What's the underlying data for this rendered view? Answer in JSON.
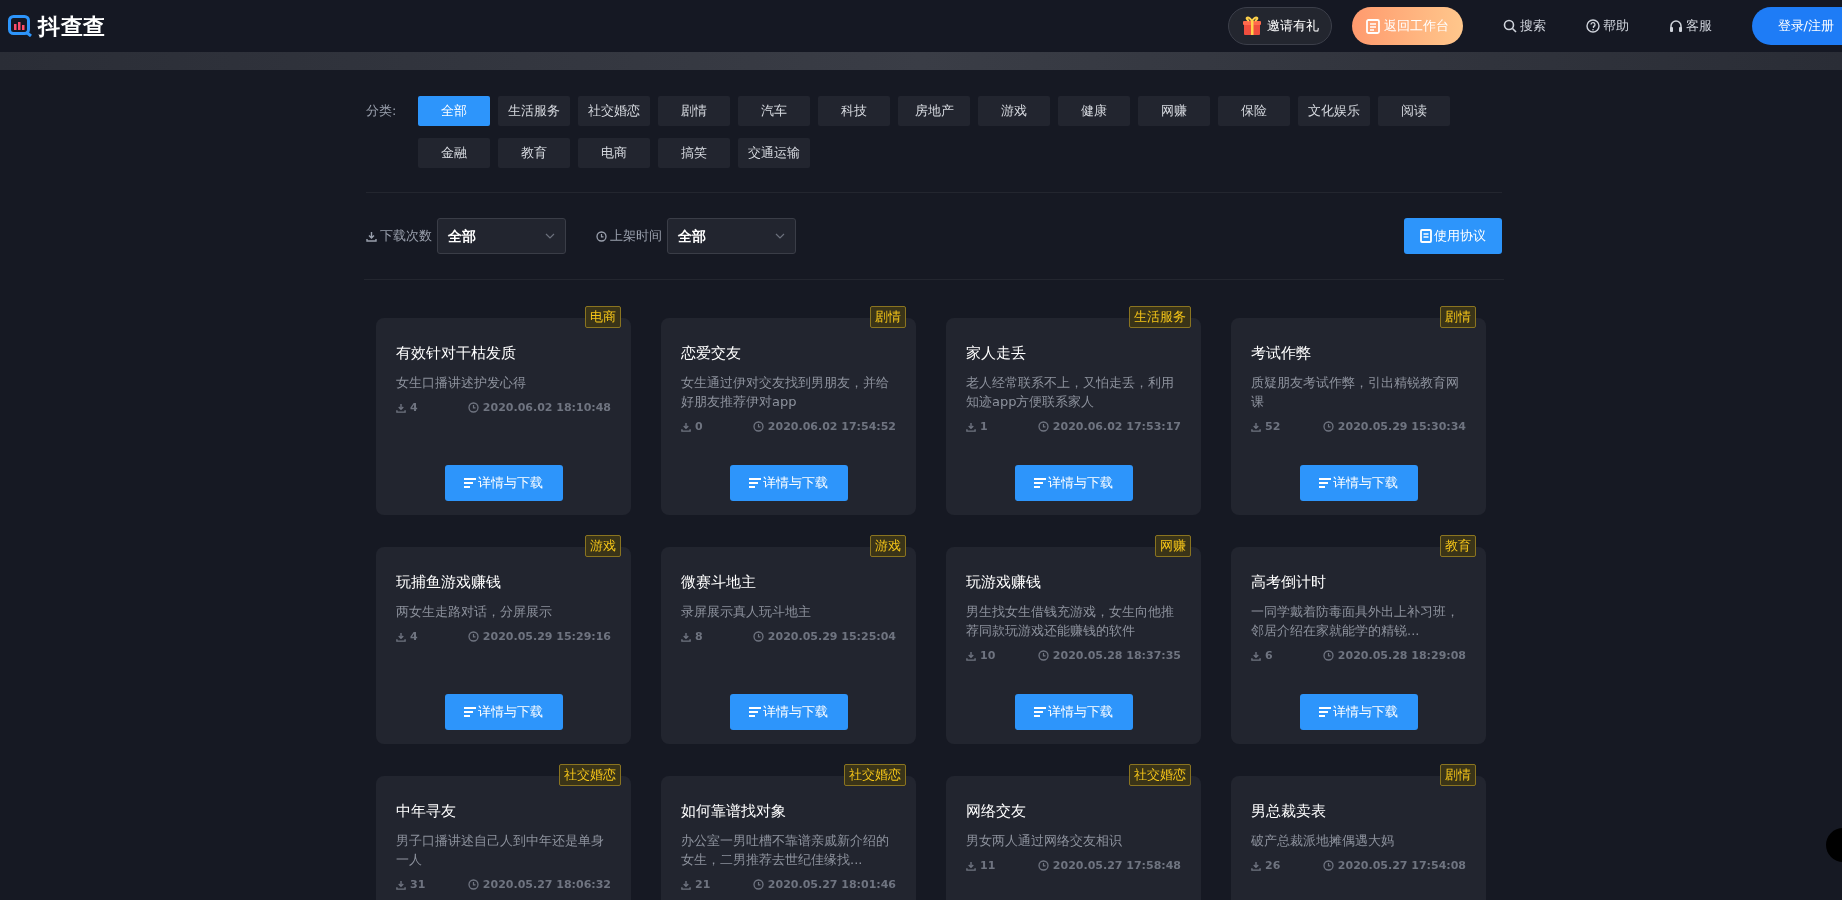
{
  "header": {
    "logo": "抖查查",
    "invite": "邀请有礼",
    "workbench": "返回工作台",
    "nav": [
      {
        "kind": "search",
        "label": "搜索"
      },
      {
        "kind": "help",
        "label": "帮助"
      },
      {
        "kind": "service",
        "label": "客服"
      }
    ],
    "login": "登录/注册"
  },
  "categories": {
    "label": "分类:",
    "items": [
      {
        "label": "全部",
        "selected": true
      },
      {
        "label": "生活服务",
        "selected": false
      },
      {
        "label": "社交婚恋",
        "selected": false
      },
      {
        "label": "剧情",
        "selected": false
      },
      {
        "label": "汽车",
        "selected": false
      },
      {
        "label": "科技",
        "selected": false
      },
      {
        "label": "房地产",
        "selected": false
      },
      {
        "label": "游戏",
        "selected": false
      },
      {
        "label": "健康",
        "selected": false
      },
      {
        "label": "网赚",
        "selected": false
      },
      {
        "label": "保险",
        "selected": false
      },
      {
        "label": "文化娱乐",
        "selected": false
      },
      {
        "label": "阅读",
        "selected": false
      },
      {
        "label": "金融",
        "selected": false
      },
      {
        "label": "教育",
        "selected": false
      },
      {
        "label": "电商",
        "selected": false
      },
      {
        "label": "搞笑",
        "selected": false
      },
      {
        "label": "交通运输",
        "selected": false
      }
    ]
  },
  "filters": [
    {
      "kind": "download",
      "label": "下载次数",
      "value": "全部"
    },
    {
      "kind": "time",
      "label": "上架时间",
      "value": "全部"
    }
  ],
  "agreement_button": "使用协议",
  "cards": [
    {
      "tag": "电商",
      "title": "有效针对干枯发质",
      "description": "女生口播讲述护发心得",
      "downloads": "4",
      "time": "2020.06.02 18:10:48",
      "button": "详情与下载"
    },
    {
      "tag": "剧情",
      "title": "恋爱交友",
      "description": "女生通过伊对交友找到男朋友，并给好朋友推荐伊对app",
      "downloads": "0",
      "time": "2020.06.02 17:54:52",
      "button": "详情与下载"
    },
    {
      "tag": "生活服务",
      "title": "家人走丢",
      "description": "老人经常联系不上，又怕走丢，利用知迹app方便联系家人",
      "downloads": "1",
      "time": "2020.06.02 17:53:17",
      "button": "详情与下载"
    },
    {
      "tag": "剧情",
      "title": "考试作弊",
      "description": "质疑朋友考试作弊，引出精锐教育网课",
      "downloads": "52",
      "time": "2020.05.29 15:30:34",
      "button": "详情与下载"
    },
    {
      "tag": "游戏",
      "title": "玩捕鱼游戏赚钱",
      "description": "两女生走路对话，分屏展示",
      "downloads": "4",
      "time": "2020.05.29 15:29:16",
      "button": "详情与下载"
    },
    {
      "tag": "游戏",
      "title": "微赛斗地主",
      "description": "录屏展示真人玩斗地主",
      "downloads": "8",
      "time": "2020.05.29 15:25:04",
      "button": "详情与下载"
    },
    {
      "tag": "网赚",
      "title": "玩游戏赚钱",
      "description": "男生找女生借钱充游戏，女生向他推荐同款玩游戏还能赚钱的软件",
      "downloads": "10",
      "time": "2020.05.28 18:37:35",
      "button": "详情与下载"
    },
    {
      "tag": "教育",
      "title": "高考倒计时",
      "description": "一同学戴着防毒面具外出上补习班，邻居介绍在家就能学的精锐...",
      "downloads": "6",
      "time": "2020.05.28 18:29:08",
      "button": "详情与下载"
    },
    {
      "tag": "社交婚恋",
      "title": "中年寻友",
      "description": "男子口播讲述自己人到中年还是单身一人",
      "downloads": "31",
      "time": "2020.05.27 18:06:32"
    },
    {
      "tag": "社交婚恋",
      "title": "如何靠谱找对象",
      "description": "办公室一男吐槽不靠谱亲戚新介绍的女生，二男推荐去世纪佳缘找...",
      "downloads": "21",
      "time": "2020.05.27 18:01:46"
    },
    {
      "tag": "社交婚恋",
      "title": "网络交友",
      "description": "男女两人通过网络交友相识",
      "downloads": "11",
      "time": "2020.05.27 17:58:48"
    },
    {
      "tag": "剧情",
      "title": "男总裁卖表",
      "description": "破产总裁派地摊偶遇大妈",
      "downloads": "26",
      "time": "2020.05.27 17:54:08"
    }
  ]
}
